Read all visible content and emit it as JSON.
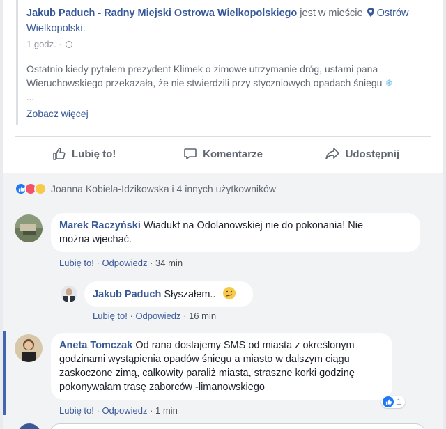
{
  "shared_post": {
    "author": "Jakub Paduch - Radny Miejski Ostrowa Wielkopolskiego",
    "in_city_label": "jest w mieście",
    "place_line1": "Ostrów",
    "place_line2": "Wielkopolski.",
    "time": "1 godz.",
    "separator": "·",
    "text_line1": "Ostatnio kiedy pytałem prezydent Klimek o zimowe utrzymanie dróg, ustami pana",
    "text_line2": "Wieruchowskiego przekazała, że nie stwierdzili przy styczniowych opadach śniegu",
    "snow_glyph": "❄",
    "ellipsis": "...",
    "see_more": "Zobacz więcej"
  },
  "actions": {
    "like": "Lubię to!",
    "comment": "Komentarze",
    "share": "Udostępnij"
  },
  "reactions": {
    "names": "Joanna Kobiela-Idzikowska i 4 innych użytkowników"
  },
  "comments": [
    {
      "name": "Marek Raczyński",
      "text_line1": "Wiadukt na Odolanowskiej nie do pokonania! Nie",
      "text_line2": "można wjechać.",
      "like": "Lubię to!",
      "reply": "Odpowiedz",
      "time": "34 min"
    },
    {
      "name": "Jakub Paduch",
      "text_line1": "Słyszałem..",
      "like": "Lubię to!",
      "reply": "Odpowiedz",
      "time": "16 min"
    },
    {
      "name": "Aneta Tomczak",
      "text_line1": "Od rana dostajemy SMS od miasta z określonym",
      "text_line2": "godzinami wystąpienia opadów śniegu a miasto w dalszym ciągu",
      "text_line3": "zaskoczone zimą, całkowity paraliż miasta, straszne korki godzinę",
      "text_line4": "pokonywałam trasę zaborców -limanowskiego",
      "like": "Lubię to!",
      "reply": "Odpowiedz",
      "time": "1 min",
      "like_count": "1"
    }
  ],
  "colors": {
    "link_blue": "#385898",
    "reply_accent": "#4267b2",
    "like_blue": "#2078f4"
  }
}
